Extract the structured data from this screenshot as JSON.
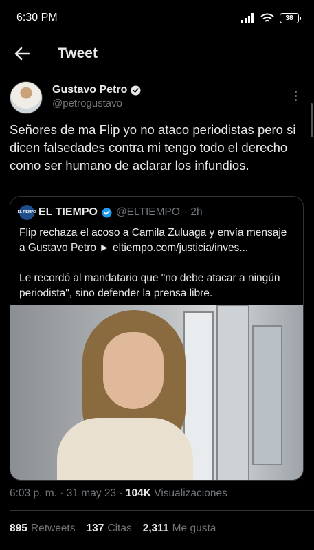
{
  "status_bar": {
    "time": "6:30 PM",
    "battery": "38"
  },
  "header": {
    "title": "Tweet"
  },
  "tweet": {
    "author_name": "Gustavo Petro",
    "author_handle": "@petrogustavo",
    "text": "Señores de ma Flip yo no ataco periodistas pero si dicen falsedades contra mi tengo todo el derecho como ser humano de aclarar los infundios.",
    "time": "6:03 p. m.",
    "separator": "·",
    "date": "31 may 23",
    "views_count": "104K",
    "views_label": "Visualizaciones"
  },
  "quoted": {
    "avatar_text": "EL TIEMPO",
    "name": "EL TIEMPO",
    "handle": "@ELTIEMPO",
    "time": "· 2h",
    "paragraph1": "Flip rechaza el acoso a Camila Zuluaga y envía mensaje a Gustavo Petro ► eltiempo.com/justicia/inves...",
    "paragraph2": "Le recordó al mandatario que \"no debe atacar a ningún periodista\", sino defender la prensa libre."
  },
  "stats": {
    "retweets_count": "895",
    "retweets_label": "Retweets",
    "quotes_count": "137",
    "quotes_label": "Citas",
    "likes_count": "2,311",
    "likes_label": "Me gusta"
  },
  "colors": {
    "background": "#000000",
    "text": "#e7e9ea",
    "secondary": "#71767b",
    "verified": "#1d9bf0",
    "divider": "#2f3336"
  }
}
